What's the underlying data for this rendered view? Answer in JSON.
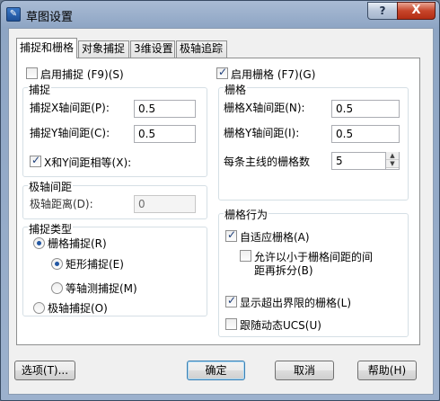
{
  "window": {
    "title": "草图设置",
    "help_btn": "?",
    "close_btn": "X"
  },
  "tabs": [
    {
      "label": "捕捉和栅格",
      "active": true
    },
    {
      "label": "对象捕捉",
      "active": false
    },
    {
      "label": "3维设置",
      "active": false
    },
    {
      "label": "极轴追踪",
      "active": false
    }
  ],
  "snap": {
    "enable_label": "启用捕捉 (F9)(S)",
    "enabled": false,
    "group_title": "捕捉",
    "x_spacing_label": "捕捉X轴间距(P):",
    "x_spacing_value": "0.5",
    "y_spacing_label": "捕捉Y轴间距(C):",
    "y_spacing_value": "0.5",
    "equal_label": "X和Y间距相等(X):",
    "equal_checked": true
  },
  "polar": {
    "group_title": "极轴间距",
    "distance_label": "极轴距离(D):",
    "distance_value": "0"
  },
  "snap_type": {
    "group_title": "捕捉类型",
    "grid_snap": "栅格捕捉(R)",
    "rect_snap": "矩形捕捉(E)",
    "iso_snap": "等轴测捕捉(M)",
    "polar_snap": "极轴捕捉(O)"
  },
  "grid": {
    "enable_label": "启用栅格 (F7)(G)",
    "enabled": true,
    "group_title": "栅格",
    "x_spacing_label": "栅格X轴间距(N):",
    "x_spacing_value": "0.5",
    "y_spacing_label": "栅格Y轴间距(I):",
    "y_spacing_value": "0.5",
    "major_label": "每条主线的栅格数",
    "major_value": "5"
  },
  "grid_behavior": {
    "group_title": "栅格行为",
    "adaptive": "自适应栅格(A)",
    "allow_subdivide_line1": "允许以小于栅格间距的间",
    "allow_subdivide_line2": "距再拆分(B)",
    "beyond_limits": "显示超出界限的栅格(L)",
    "follow_ucs": "跟随动态UCS(U)"
  },
  "buttons": {
    "options": "选项(T)...",
    "ok": "确定",
    "cancel": "取消",
    "help": "帮助(H)"
  }
}
